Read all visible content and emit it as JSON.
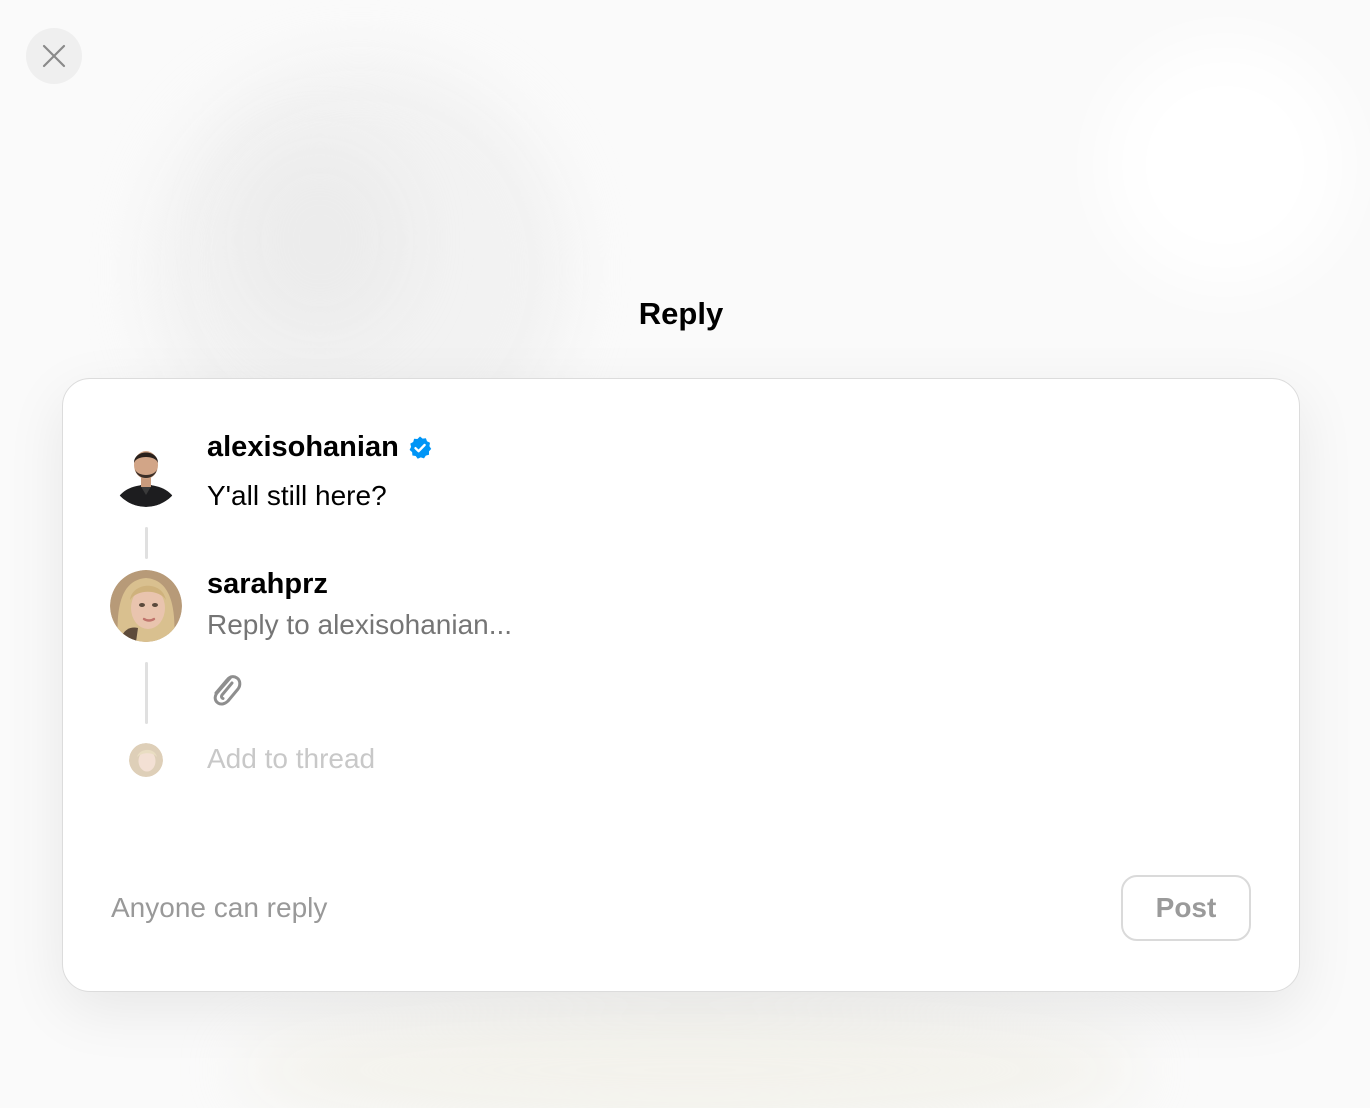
{
  "modal": {
    "title": "Reply",
    "close_icon": "close-icon"
  },
  "original_post": {
    "username": "alexisohanian",
    "verified": true,
    "verified_icon": "verified-badge-icon",
    "text": "Y'all still here?"
  },
  "reply": {
    "username": "sarahprz",
    "placeholder": "Reply to alexisohanian...",
    "attach_icon": "paperclip-icon",
    "add_to_thread": "Add to thread"
  },
  "footer": {
    "audience_label": "Anyone can reply",
    "post_label": "Post"
  },
  "colors": {
    "verified_blue": "#0095f6",
    "muted_text": "#999999",
    "faint_text": "#c8c8c8",
    "border": "#dcdcdc"
  }
}
